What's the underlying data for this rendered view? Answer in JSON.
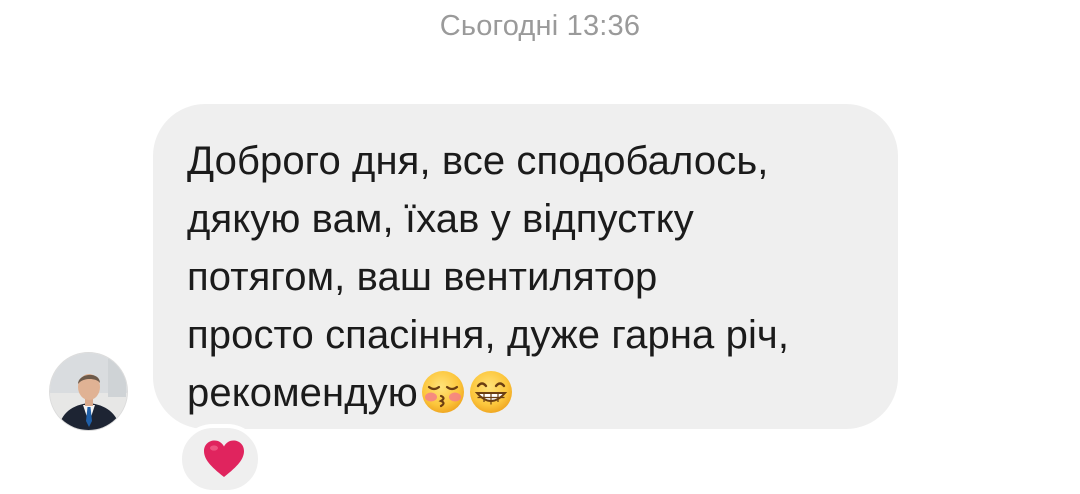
{
  "chat": {
    "timestamp": "Сьогодні 13:36",
    "message": {
      "text": "Доброго дня, все сподобалось,\nдякую вам, їхав у відпустку\nпотягом, ваш вентилятор\nпросто спасіння, дуже гарна річ,\nрекомендую",
      "emojis": [
        "kissing-face-with-closed-eyes-emoji",
        "grinning-face-emoji"
      ],
      "bubble_color": "#efefef",
      "text_color": "#1b1b1b"
    },
    "reaction": {
      "icon": "red-heart-icon",
      "color": "#e0245e"
    },
    "sender_avatar": "user-avatar-photo"
  }
}
